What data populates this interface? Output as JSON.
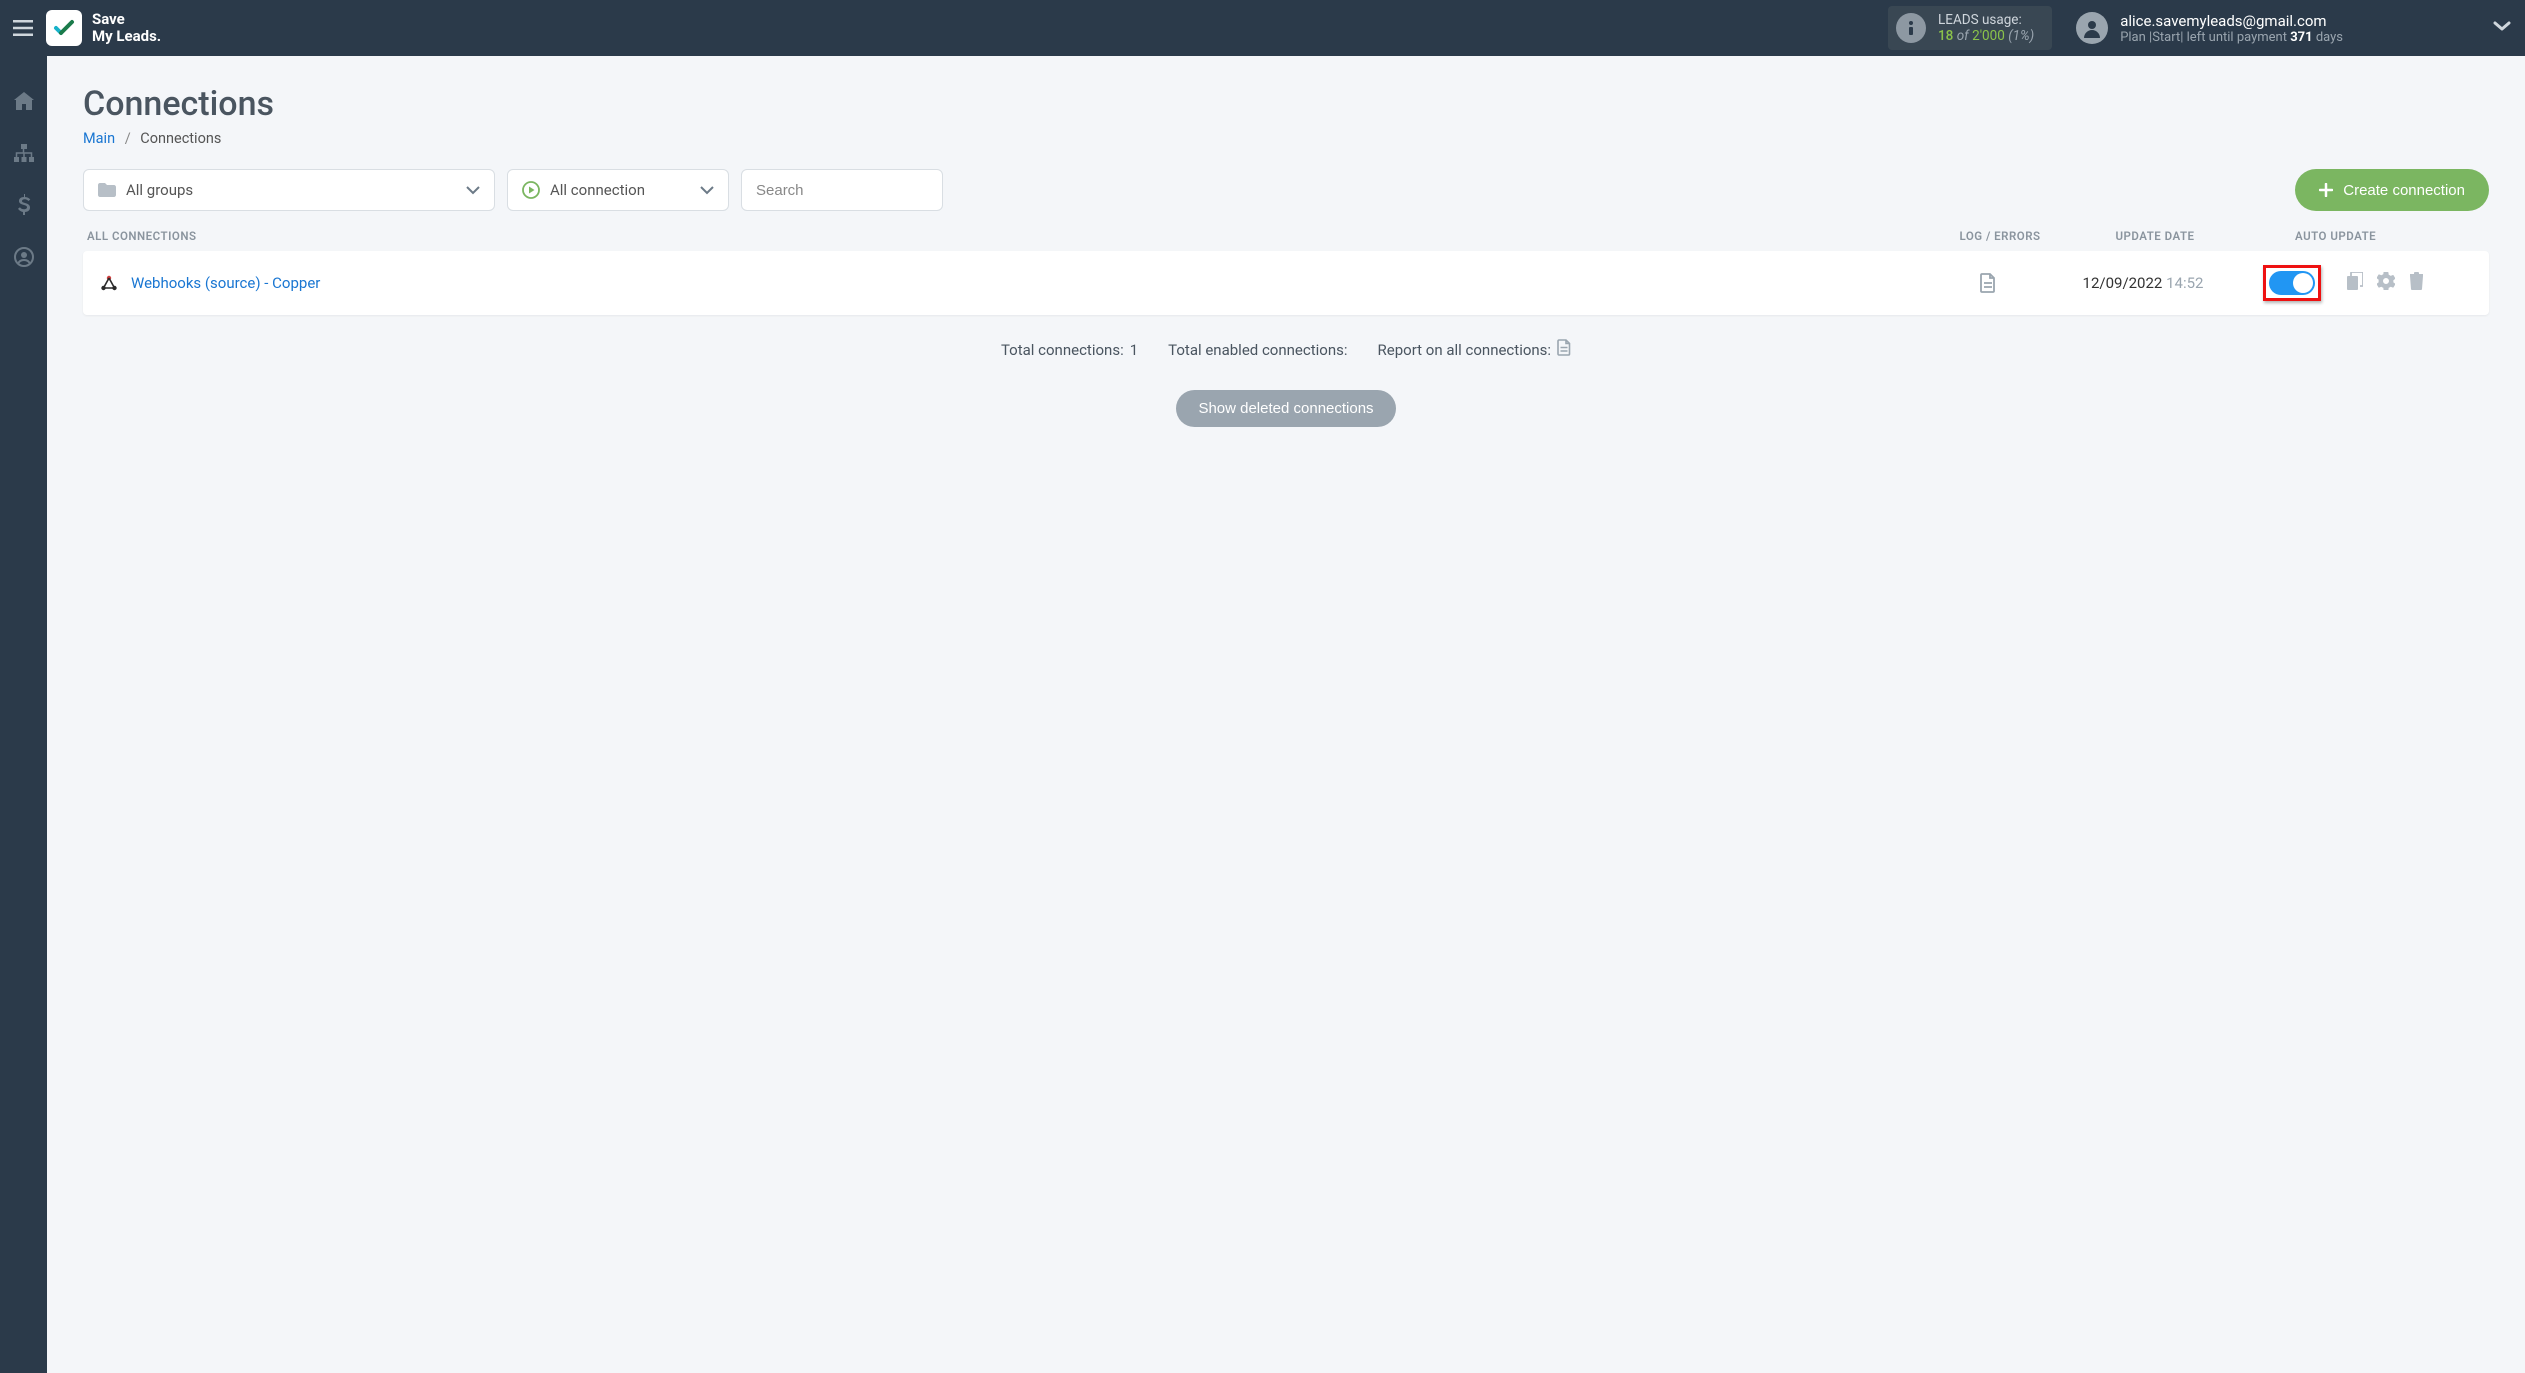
{
  "brand": {
    "line1": "Save",
    "line2": "My Leads."
  },
  "usage": {
    "label": "LEADS usage:",
    "used": "18",
    "of": "of",
    "total": "2'000",
    "percent": "(1%)"
  },
  "account": {
    "email": "alice.savemyleads@gmail.com",
    "plan_prefix": "Plan |Start| left until payment",
    "days_number": "371",
    "days_word": "days"
  },
  "page": {
    "title": "Connections",
    "breadcrumb_main": "Main",
    "breadcrumb_current": "Connections"
  },
  "filters": {
    "groups_label": "All groups",
    "status_label": "All connection",
    "search_placeholder": "Search"
  },
  "buttons": {
    "create": "Create connection",
    "show_deleted": "Show deleted connections"
  },
  "columns": {
    "all": "All connections",
    "log": "Log / Errors",
    "date": "Update date",
    "auto": "Auto update"
  },
  "rows": [
    {
      "name": "Webhooks (source) - Copper",
      "date": "12/09/2022",
      "time": "14:52",
      "auto_update": true
    }
  ],
  "summary": {
    "total_label": "Total connections:",
    "total_value": "1",
    "enabled_label": "Total enabled connections:",
    "report_label": "Report on all connections:"
  }
}
